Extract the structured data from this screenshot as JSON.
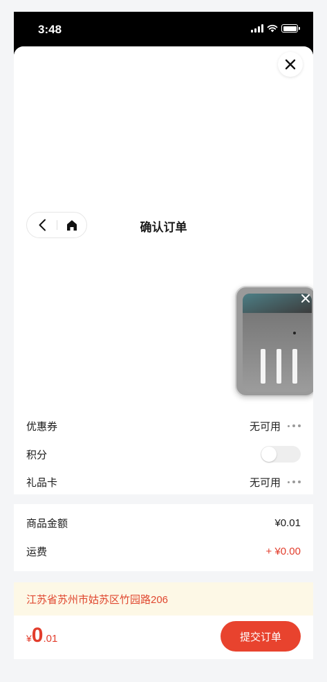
{
  "status_bar": {
    "time": "3:48"
  },
  "header": {
    "title": "确认订单"
  },
  "discounts": {
    "coupon_label": "优惠券",
    "coupon_value": "无可用",
    "points_label": "积分",
    "giftcard_label": "礼品卡",
    "giftcard_value": "无可用"
  },
  "summary": {
    "goods_label": "商品金额",
    "goods_value": "¥0.01",
    "shipping_label": "运费",
    "shipping_value": "+ ¥0.00"
  },
  "address": {
    "text": "江苏省苏州市姑苏区竹园路206"
  },
  "footer": {
    "price_currency": "¥",
    "price_integer": "0",
    "price_decimal": ".01",
    "submit_label": "提交订单"
  },
  "colors": {
    "accent": "#e8432e",
    "address_bg": "#fdf8e6"
  }
}
